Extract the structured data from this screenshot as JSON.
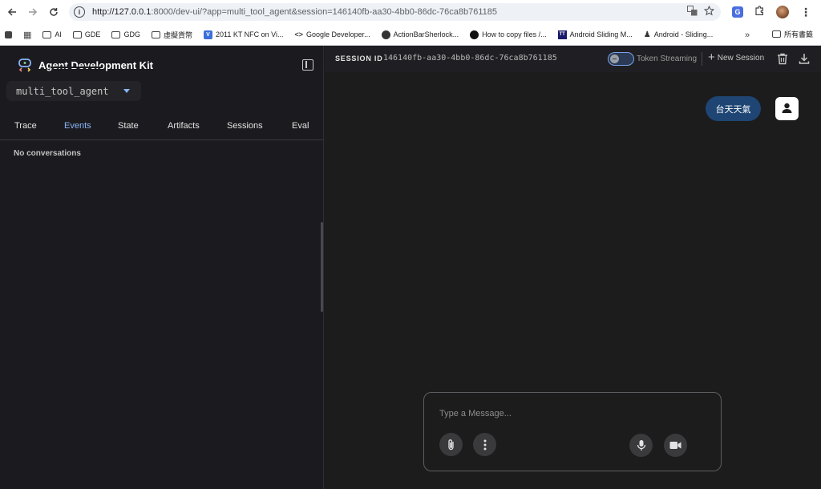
{
  "browser": {
    "url_host": "http://127.0.0.1",
    "url_path": ":8000/dev-ui/?app=multi_tool_agent&session=146140fb-aa30-4bb0-86dc-76ca8b761185",
    "bookmarks": [
      {
        "label": "AI",
        "icon": "folder-icon"
      },
      {
        "label": "GDE",
        "icon": "folder-icon"
      },
      {
        "label": "GDG",
        "icon": "folder-icon"
      },
      {
        "label": "虛擬貨幣",
        "icon": "folder-icon"
      },
      {
        "label": "2011 KT NFC on Vi...",
        "icon": "v-badge-icon"
      },
      {
        "label": "Google Developer...",
        "icon": "code-icon"
      },
      {
        "label": "ActionBarSherlock...",
        "icon": "globe-icon"
      },
      {
        "label": "How to copy files /...",
        "icon": "github-icon"
      },
      {
        "label": "Android Sliding M...",
        "icon": "tt-icon"
      },
      {
        "label": "Android - Sliding...",
        "icon": "person-icon"
      }
    ],
    "bookmarks_more": "»",
    "bookmarks_folder": "所有書籤"
  },
  "app": {
    "title": "Agent Development Kit",
    "agent_selected": "multi_tool_agent",
    "tabs": [
      "Trace",
      "Events",
      "State",
      "Artifacts",
      "Sessions",
      "Eval"
    ],
    "active_tab": "Events",
    "empty_message": "No conversations"
  },
  "session": {
    "label": "SESSION ID",
    "id": "146140fb-aa30-4bb0-86dc-76ca8b761185",
    "token_streaming_label": "Token Streaming",
    "token_streaming_on": false,
    "new_session_label": "New Session"
  },
  "chat": {
    "messages": [
      {
        "role": "user",
        "text": "台天天氣"
      }
    ]
  },
  "composer": {
    "placeholder": "Type a Message..."
  },
  "colors": {
    "accent": "#8ab4f8",
    "user_bubble": "#1e4573",
    "background": "#1b1b1f"
  }
}
